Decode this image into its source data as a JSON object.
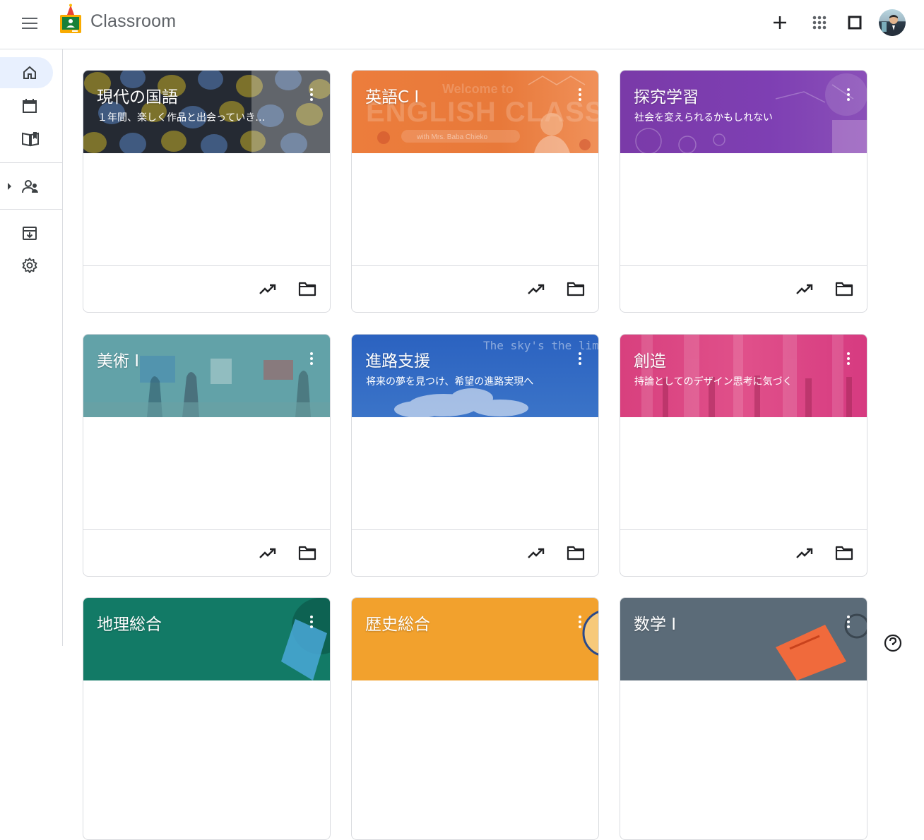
{
  "app": {
    "title": "Classroom"
  },
  "icons": {
    "menu": "menu-icon",
    "logo": "classroom-logo",
    "add": "plus-icon",
    "apps": "apps-grid-icon",
    "window": "square-icon",
    "account": "avatar",
    "home": "home-icon",
    "calendar": "calendar-icon",
    "book": "book-icon",
    "people": "people-icon",
    "archive": "archive-icon",
    "settings": "gear-icon",
    "more": "more-vert-icon",
    "trend": "trending-up-icon",
    "folder": "folder-icon",
    "help": "help-icon"
  },
  "cards": [
    {
      "title": "現代の国語",
      "subtitle": "１年間、楽しく作品と出会っていき…",
      "banner_image_text": ""
    },
    {
      "title": "英語C Ⅰ",
      "subtitle": "",
      "banner_image_text": "Welcome to ENGLISH CLASS with Mrs. Baba Chieko"
    },
    {
      "title": "探究学習",
      "subtitle": "社会を変えられるかもしれない",
      "banner_image_text": ""
    },
    {
      "title": "美術 Ⅰ",
      "subtitle": "",
      "banner_image_text": ""
    },
    {
      "title": "進路支援",
      "subtitle": "将来の夢を見つけ、希望の進路実現へ",
      "banner_image_text": "The sky's the limit."
    },
    {
      "title": "創造",
      "subtitle": "持論としてのデザイン思考に気づく",
      "banner_image_text": ""
    },
    {
      "title": "地理総合",
      "subtitle": "",
      "banner_image_text": ""
    },
    {
      "title": "歴史総合",
      "subtitle": "",
      "banner_image_text": ""
    },
    {
      "title": "数学 Ⅰ",
      "subtitle": "",
      "banner_image_text": ""
    }
  ],
  "colors": {
    "accent": "#1a73e8",
    "active_nav": "#e8f0fe",
    "border": "#dadce0",
    "icon": "#5f6368",
    "banners": [
      "#252a33",
      "#e8793a",
      "#7b3fb1",
      "#5a9aa0",
      "#2c63c2",
      "#dc3d80",
      "#127a66",
      "#f2a12d",
      "#5b6b78"
    ]
  }
}
